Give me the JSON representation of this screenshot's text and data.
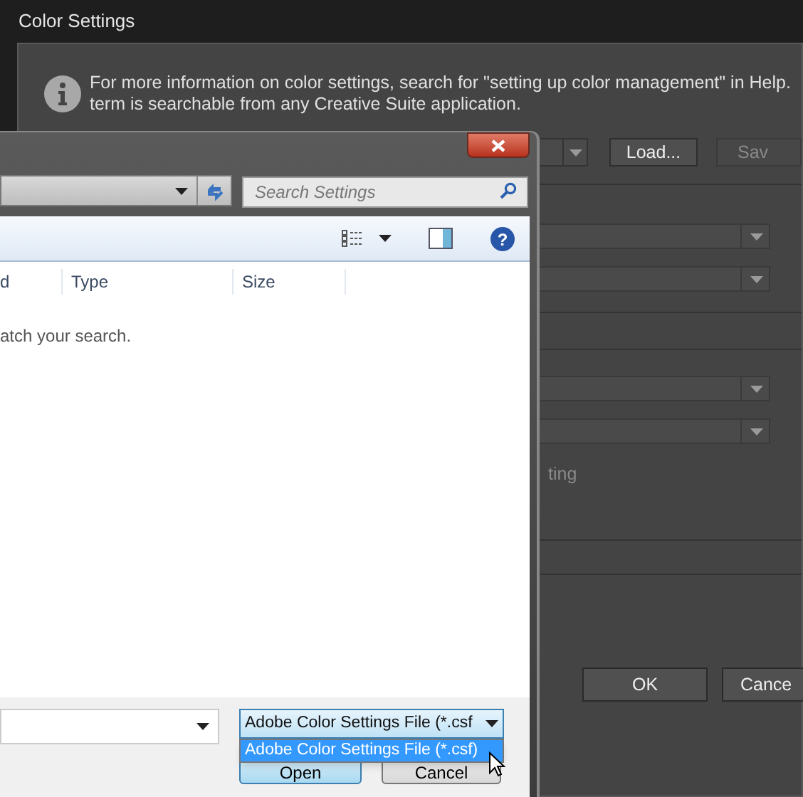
{
  "background_dialog": {
    "title": "Color Settings",
    "info_lines": [
      "For more information on color settings, search for \"setting up color management\" in Help.",
      "term is searchable from any Creative Suite application."
    ],
    "top_buttons": [
      "Load...",
      "Sav"
    ],
    "option_fragment": "ting",
    "bottom_buttons": [
      "OK",
      "Cance"
    ]
  },
  "file_dialog": {
    "search": {
      "placeholder": "Search Settings"
    },
    "help_symbol": "?",
    "columns": [
      "d",
      "Type",
      "Size"
    ],
    "empty_message": "atch your search.",
    "file_type": {
      "value": "Adobe Color Settings File (*.csf",
      "options": [
        {
          "label": "Adobe Color Settings File (*.csf)",
          "selected": true
        }
      ]
    },
    "buttons": [
      "Open",
      "Cancel"
    ]
  }
}
